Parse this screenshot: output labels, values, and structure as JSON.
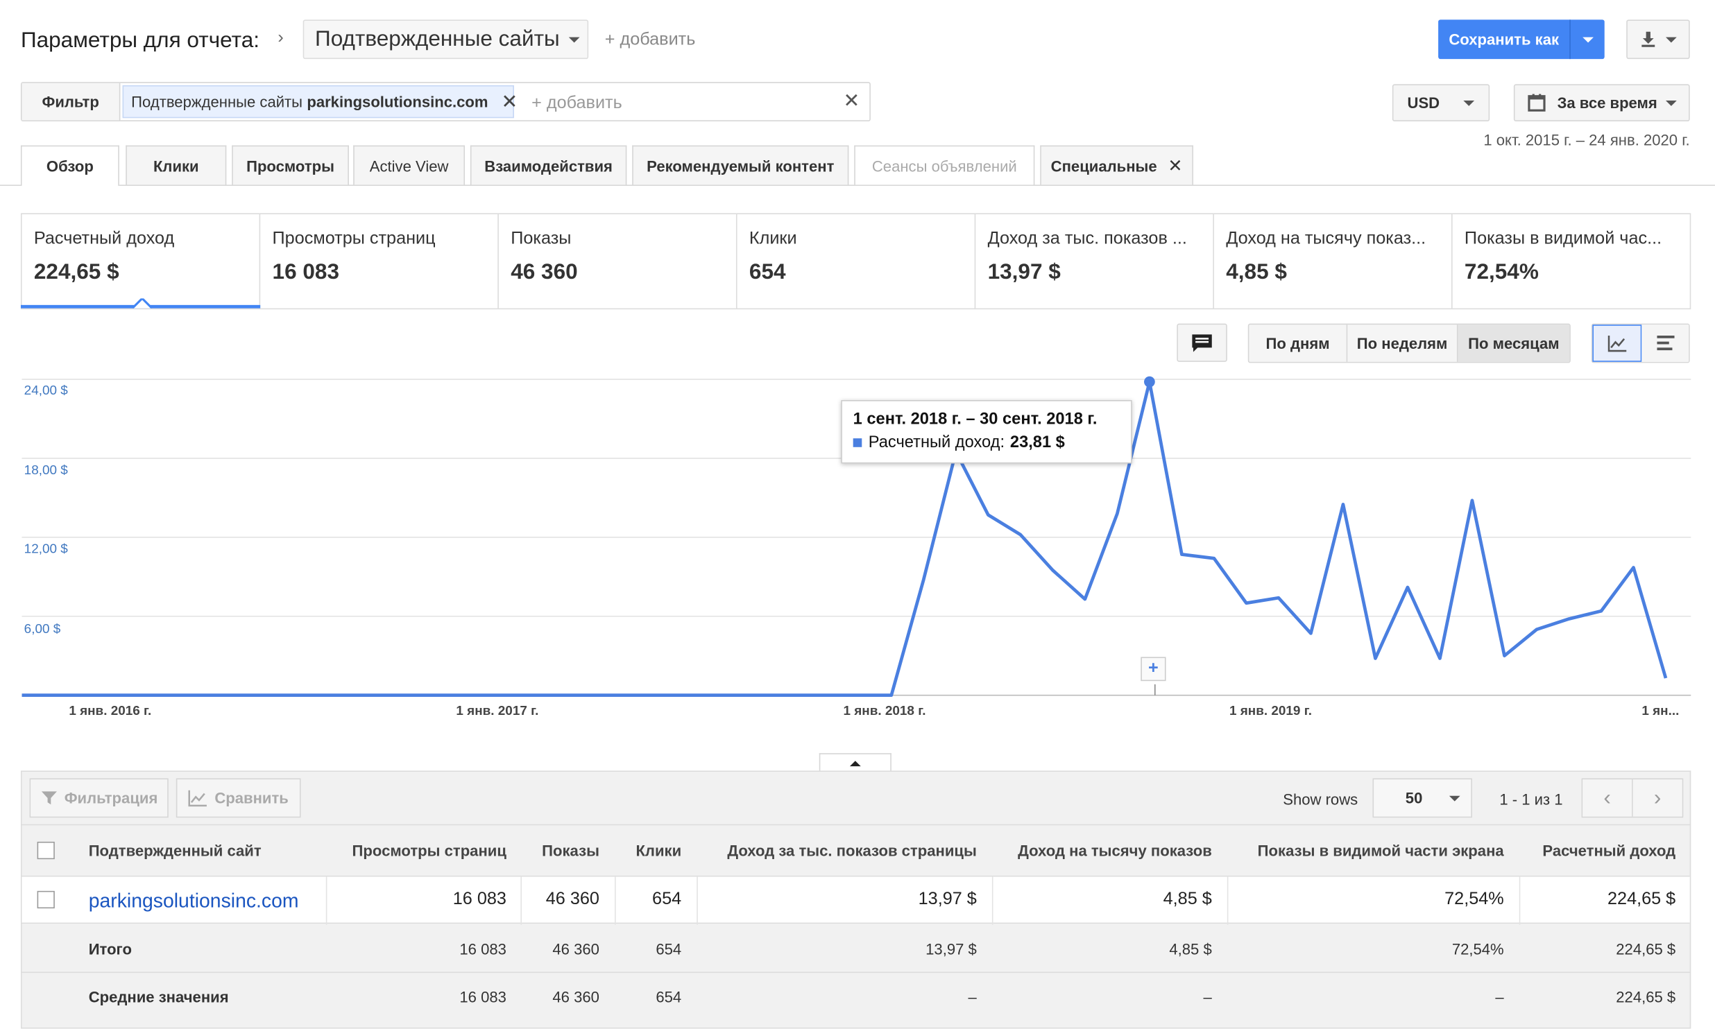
{
  "header": {
    "title": "Параметры для отчета:",
    "dimension": "Подтвержденные сайты",
    "add": "+ добавить",
    "save_as": "Сохранить как"
  },
  "filter": {
    "label": "Фильтр",
    "chip_prefix": "Подтвержденные сайты",
    "chip_value": "parkingsolutionsinc.com",
    "add_placeholder": "+ добавить"
  },
  "currency": "USD",
  "date_range": {
    "label": "За все время",
    "range": "1 окт. 2015 г. – 24 янв. 2020 г."
  },
  "tabs": [
    "Обзор",
    "Клики",
    "Просмотры",
    "Active View",
    "Взаимодействия",
    "Рекомендуемый контент",
    "Сеансы объявлений",
    "Специальные"
  ],
  "metrics": [
    {
      "label": "Расчетный доход",
      "value": "224,65 $"
    },
    {
      "label": "Просмотры страниц",
      "value": "16 083"
    },
    {
      "label": "Показы",
      "value": "46 360"
    },
    {
      "label": "Клики",
      "value": "654"
    },
    {
      "label": "Доход за тыс. показов ...",
      "value": "13,97 $"
    },
    {
      "label": "Доход на тысячу показ...",
      "value": "4,85 $"
    },
    {
      "label": "Показы в видимой час...",
      "value": "72,54%"
    }
  ],
  "granularity": [
    "По дням",
    "По неделям",
    "По месяцам"
  ],
  "chart_data": {
    "type": "line",
    "y_ticks": [
      "24,00 $",
      "18,00 $",
      "12,00 $",
      "6,00 $"
    ],
    "x_ticks": [
      "1 янв. 2016 г.",
      "1 янв. 2017 г.",
      "1 янв. 2018 г.",
      "1 янв. 2019 г.",
      "1 ян..."
    ],
    "ylim": [
      0,
      24
    ],
    "series": [
      {
        "color": "#4a7fe0",
        "points": [
          [
            "2015-10",
            0
          ],
          [
            "2015-11",
            0
          ],
          [
            "2015-12",
            0
          ],
          [
            "2016-01",
            0
          ],
          [
            "2016-02",
            0
          ],
          [
            "2016-03",
            0
          ],
          [
            "2016-04",
            0
          ],
          [
            "2016-05",
            0
          ],
          [
            "2016-06",
            0
          ],
          [
            "2016-07",
            0
          ],
          [
            "2016-08",
            0
          ],
          [
            "2016-09",
            0
          ],
          [
            "2016-10",
            0
          ],
          [
            "2016-11",
            0
          ],
          [
            "2016-12",
            0
          ],
          [
            "2017-01",
            0
          ],
          [
            "2017-02",
            0
          ],
          [
            "2017-03",
            0
          ],
          [
            "2017-04",
            0
          ],
          [
            "2017-05",
            0
          ],
          [
            "2017-06",
            0
          ],
          [
            "2017-07",
            0
          ],
          [
            "2017-08",
            0
          ],
          [
            "2017-09",
            0
          ],
          [
            "2017-10",
            0
          ],
          [
            "2017-11",
            0
          ],
          [
            "2017-12",
            0
          ],
          [
            "2018-01",
            0
          ],
          [
            "2018-02",
            8.8
          ],
          [
            "2018-03",
            18.5
          ],
          [
            "2018-04",
            13.7
          ],
          [
            "2018-05",
            12.2
          ],
          [
            "2018-06",
            9.5
          ],
          [
            "2018-07",
            7.3
          ],
          [
            "2018-08",
            13.8
          ],
          [
            "2018-09",
            23.81
          ],
          [
            "2018-10",
            10.7
          ],
          [
            "2018-11",
            10.4
          ],
          [
            "2018-12",
            7.0
          ],
          [
            "2019-01",
            7.4
          ],
          [
            "2019-02",
            4.7
          ],
          [
            "2019-03",
            14.5
          ],
          [
            "2019-04",
            2.8
          ],
          [
            "2019-05",
            8.2
          ],
          [
            "2019-06",
            2.8
          ],
          [
            "2019-07",
            14.8
          ],
          [
            "2019-08",
            3.0
          ],
          [
            "2019-09",
            5.0
          ],
          [
            "2019-10",
            5.8
          ],
          [
            "2019-11",
            6.4
          ],
          [
            "2019-12",
            9.7
          ],
          [
            "2020-01",
            1.3
          ]
        ]
      }
    ],
    "tooltip": {
      "title": "1 сент. 2018 г. – 30 сент. 2018 г.",
      "series_label": "Расчетный доход:",
      "value": "23,81 $"
    }
  },
  "table": {
    "toolbar": {
      "filter": "Фильтрация",
      "compare": "Сравнить",
      "show_rows": "Show rows",
      "rows_value": "50",
      "pager": "1 - 1 из 1"
    },
    "headers": [
      "Подтвержденный сайт",
      "Просмотры страниц",
      "Показы",
      "Клики",
      "Доход за тыс. показов страницы",
      "Доход на тысячу показов",
      "Показы в видимой части экрана",
      "Расчетный доход"
    ],
    "row": {
      "site": "parkingsolutionsinc.com",
      "cells": [
        "16 083",
        "46 360",
        "654",
        "13,97 $",
        "4,85 $",
        "72,54%",
        "224,65 $"
      ]
    },
    "total": {
      "label": "Итого",
      "cells": [
        "16 083",
        "46 360",
        "654",
        "13,97 $",
        "4,85 $",
        "72,54%",
        "224,65 $"
      ]
    },
    "average": {
      "label": "Средние значения",
      "cells": [
        "16 083",
        "46 360",
        "654",
        "–",
        "–",
        "–",
        "224,65 $"
      ]
    }
  }
}
